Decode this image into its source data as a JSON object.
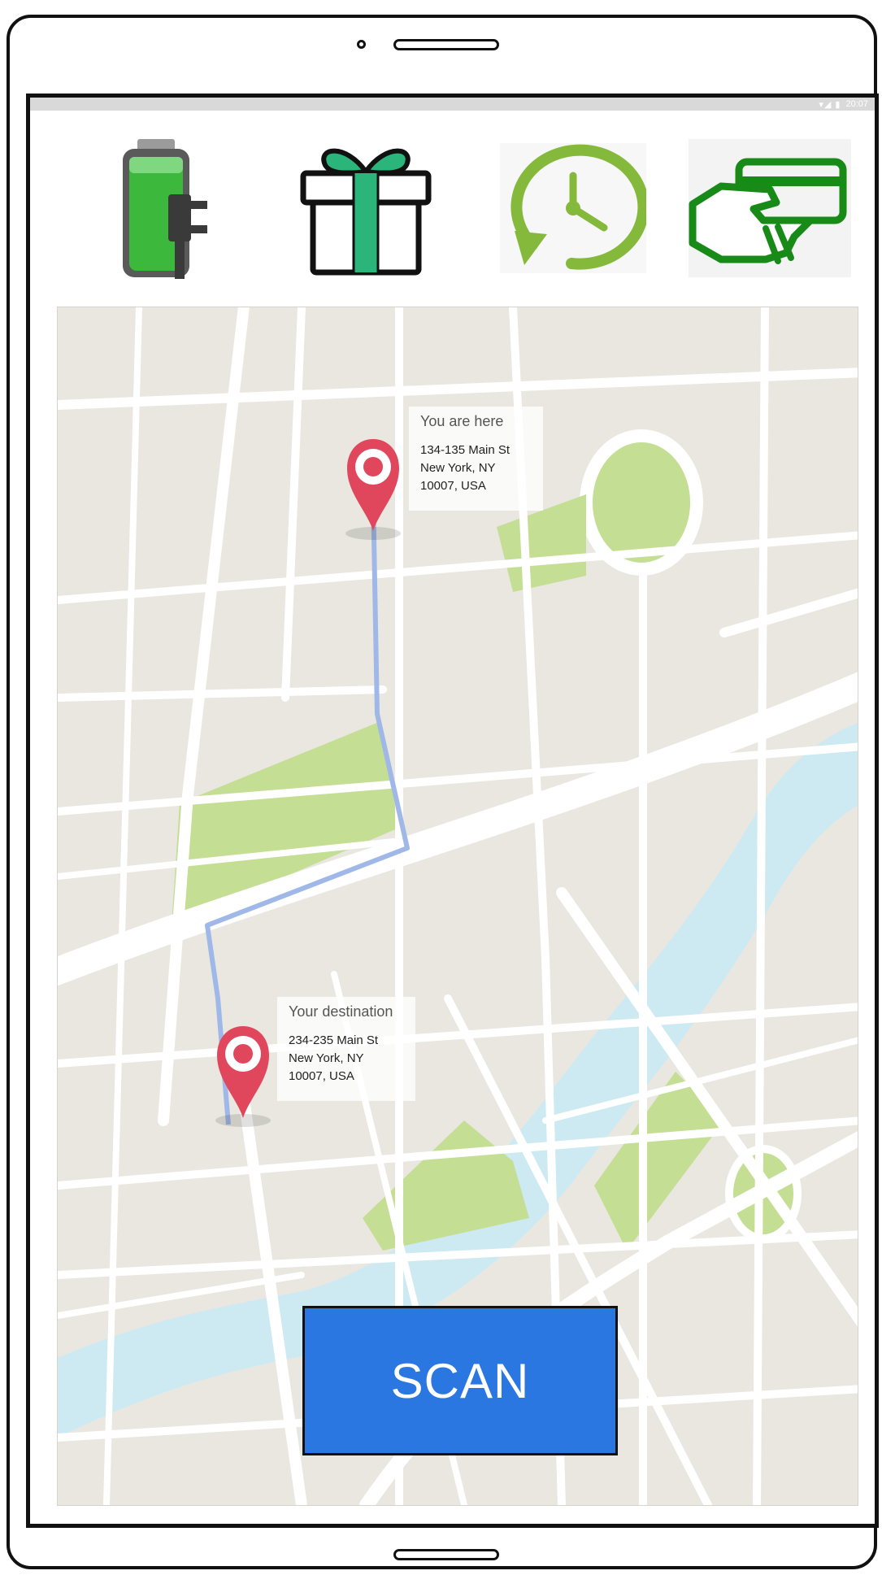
{
  "status_bar": {
    "icons": "▾◢ ▮",
    "time": "20:07"
  },
  "toolbar": {
    "items": [
      {
        "icon": "battery-charging-icon",
        "color": "#2aa32a"
      },
      {
        "icon": "gift-icon",
        "color": "#2bb57a"
      },
      {
        "icon": "clock-history-icon",
        "color": "#84b93b"
      },
      {
        "icon": "card-payment-icon",
        "color": "#178a17"
      }
    ]
  },
  "map": {
    "origin": {
      "title": "You are here",
      "line1": "134-135 Main St",
      "line2": "New York, NY 10007, USA"
    },
    "destination": {
      "title": "Your destination",
      "line1": "234-235 Main St",
      "line2": "New York, NY 10007, USA"
    },
    "colors": {
      "land": "#e9e7e0",
      "road": "#ffffff",
      "park": "#c4de94",
      "water": "#cdeaf3",
      "route": "#9fb8e8",
      "pin": "#e0475c"
    }
  },
  "scan_button": {
    "label": "SCAN",
    "color": "#2b77e2"
  }
}
